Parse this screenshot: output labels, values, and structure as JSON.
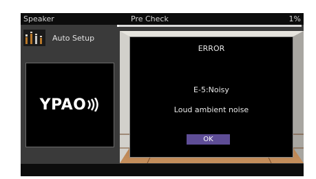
{
  "header": {
    "section_title": "Speaker",
    "step_title": "Pre Check",
    "progress_text": "1%",
    "progress_fraction": 0.01
  },
  "sidebar": {
    "autosetup_label": "Auto Setup",
    "autosetup_icon": "speaker-levels-icon",
    "logo_text": "YPAO",
    "logo_icon": "sound-waves-icon"
  },
  "dialog": {
    "title": "ERROR",
    "code": "E-5:Noisy",
    "message": "Loud ambient noise",
    "ok_label": "OK"
  },
  "colors": {
    "ok_button": "#5e4d96",
    "topbar": "#0c0c0c",
    "frame": "#3a3a3a"
  }
}
